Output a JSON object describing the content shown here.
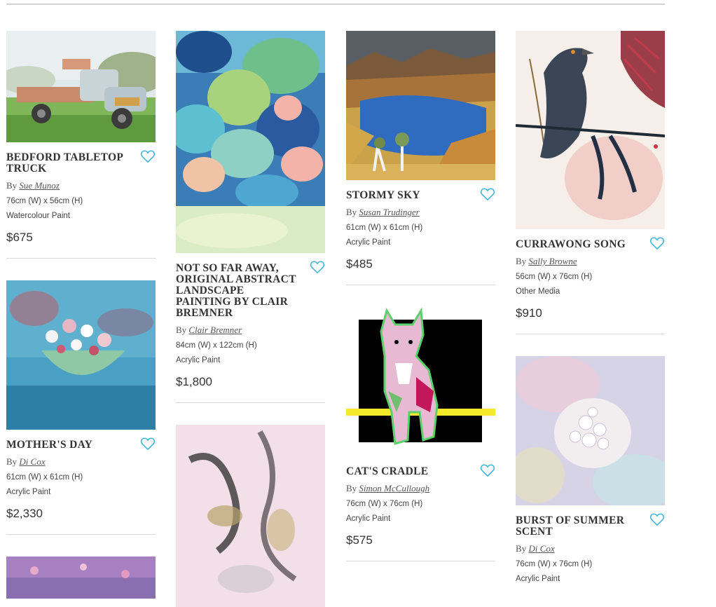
{
  "theme": {
    "heart_color": "#3fb4d6",
    "rule_color": "#d8d8d8"
  },
  "by_label": "By",
  "columns": [
    [
      {
        "title": "BEDFORD TABLETOP TRUCK",
        "artist": "Sue Munoz",
        "size": "76cm (W) x 56cm (H)",
        "medium": "Watercolour Paint",
        "price": "$675"
      },
      {
        "title": "MOTHER'S DAY",
        "artist": "Di Cox",
        "size": "61cm (W) x 61cm (H)",
        "medium": "Acrylic Paint",
        "price": "$2,330"
      }
    ],
    [
      {
        "title": "NOT SO FAR AWAY, ORIGINAL ABSTRACT LANDSCAPE PAINTING BY CLAIR BREMNER",
        "artist": "Clair Bremner",
        "size": "84cm (W) x 122cm (H)",
        "medium": "Acrylic Paint",
        "price": "$1,800"
      }
    ],
    [
      {
        "title": "STORMY SKY",
        "artist": "Susan Trudinger",
        "size": "61cm (W) x 61cm (H)",
        "medium": "Acrylic Paint",
        "price": "$485"
      },
      {
        "title": "CAT'S CRADLE",
        "artist": "Simon McCullough",
        "size": "76cm (W) x 76cm (H)",
        "medium": "Acrylic Paint",
        "price": "$575"
      }
    ],
    [
      {
        "title": "CURRAWONG SONG",
        "artist": "Sally Browne",
        "size": "56cm (W) x 76cm (H)",
        "medium": "Other Media",
        "price": "$910"
      },
      {
        "title": "BURST OF SUMMER SCENT",
        "artist": "Di Cox",
        "size": "76cm (W) x 76cm (H)",
        "medium": "Acrylic Paint",
        "price": ""
      }
    ]
  ]
}
